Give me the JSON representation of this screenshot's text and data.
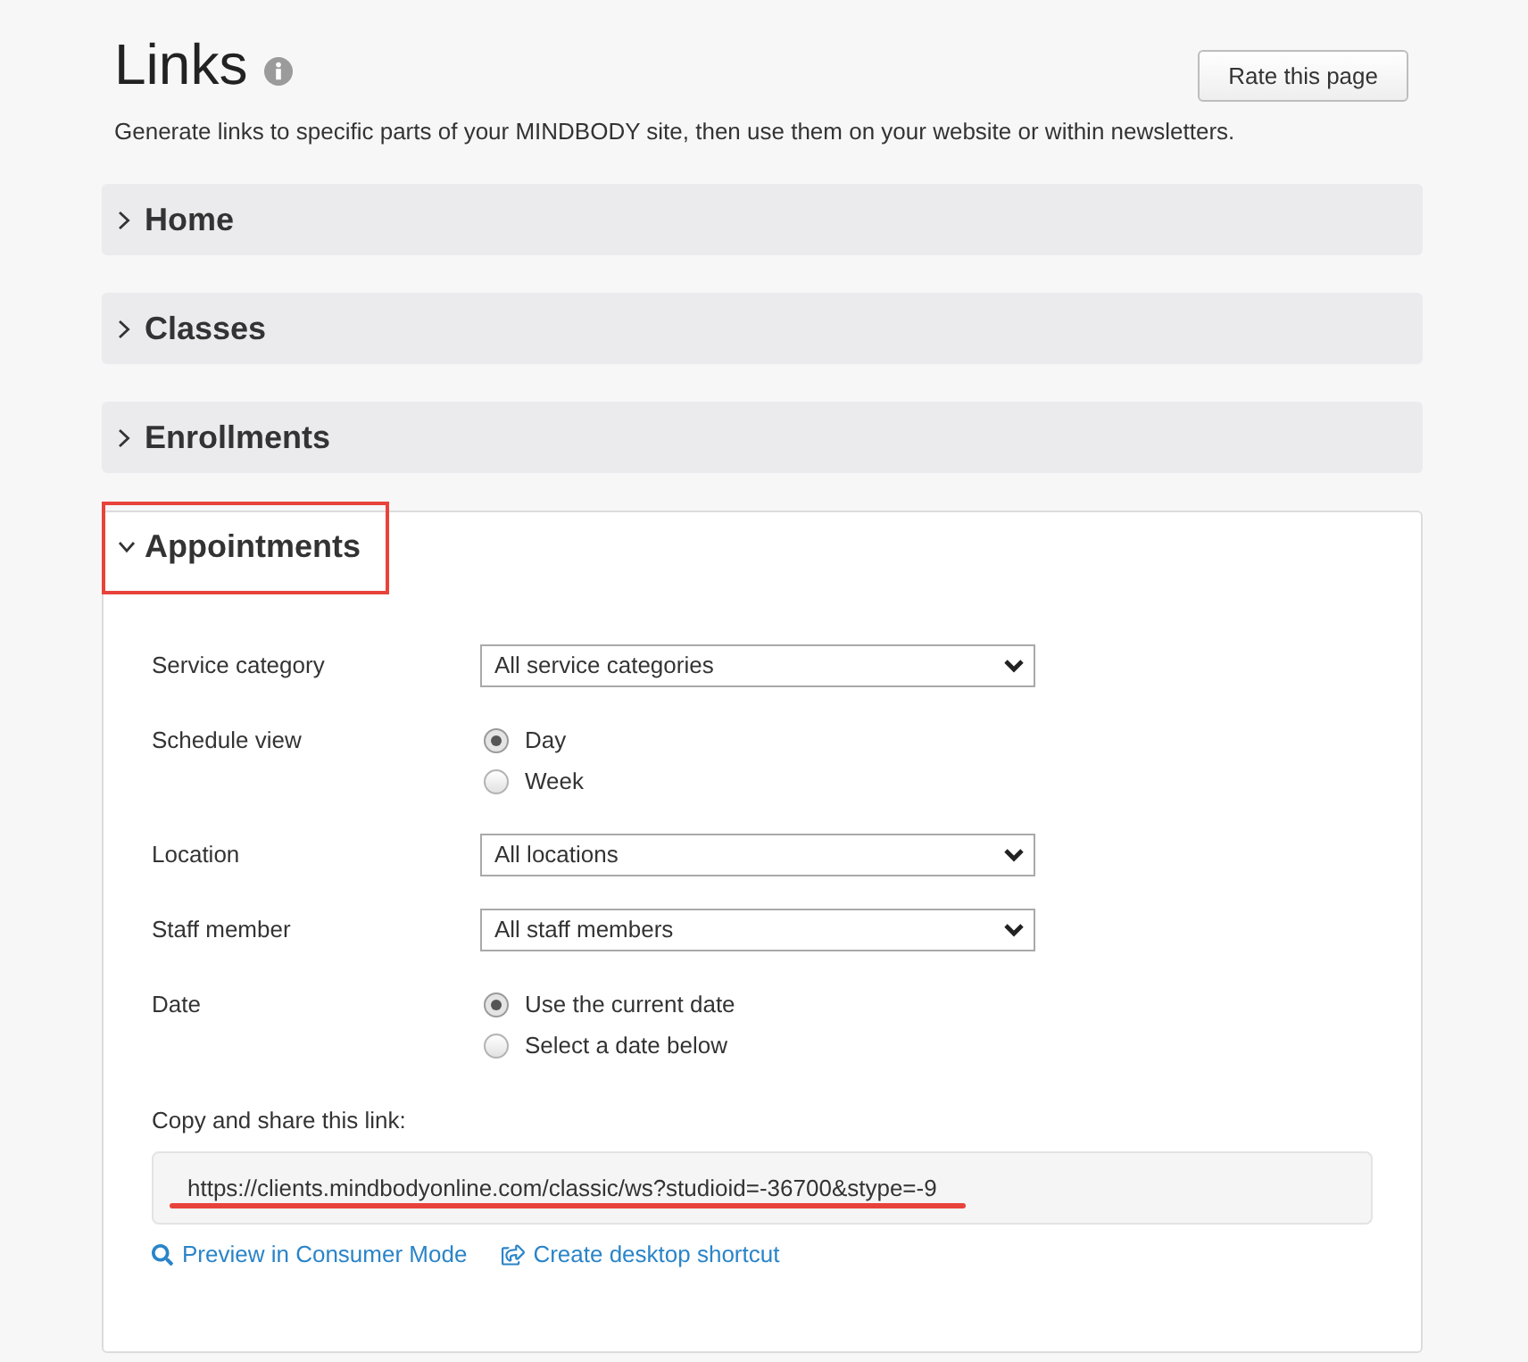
{
  "header": {
    "title": "Links",
    "description": "Generate links to specific parts of your MINDBODY site, then use them on your website or within newsletters.",
    "rate_button": "Rate this page"
  },
  "sections": [
    {
      "title": "Home",
      "expanded": false,
      "highlighted": false
    },
    {
      "title": "Classes",
      "expanded": false,
      "highlighted": false
    },
    {
      "title": "Enrollments",
      "expanded": false,
      "highlighted": false
    },
    {
      "title": "Appointments",
      "expanded": true,
      "highlighted": true,
      "fields": [
        {
          "kind": "select",
          "label": "Service category",
          "value": "All service categories"
        },
        {
          "kind": "radio",
          "label": "Schedule view",
          "options": [
            {
              "label": "Day",
              "selected": true
            },
            {
              "label": "Week",
              "selected": false
            }
          ]
        },
        {
          "kind": "select",
          "label": "Location",
          "value": "All locations"
        },
        {
          "kind": "select",
          "label": "Staff member",
          "value": "All staff members"
        },
        {
          "kind": "radio",
          "label": "Date",
          "options": [
            {
              "label": "Use the current date",
              "selected": true
            },
            {
              "label": "Select a date below",
              "selected": false
            }
          ]
        }
      ],
      "share": {
        "label": "Copy and share this link:",
        "url": "https://clients.mindbodyonline.com/classic/ws?studioid=-36700&stype=-9",
        "underlined": true,
        "actions": [
          {
            "kind": "preview",
            "label": "Preview in Consumer Mode"
          },
          {
            "kind": "shortcut",
            "label": "Create desktop shortcut"
          }
        ]
      }
    }
  ]
}
